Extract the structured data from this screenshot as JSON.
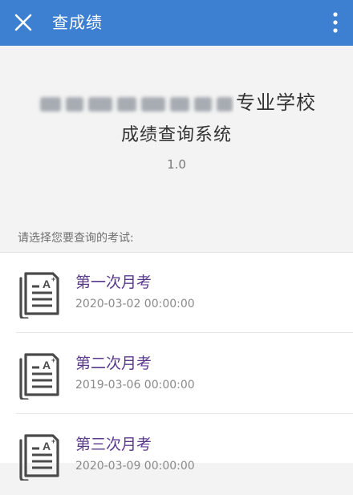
{
  "topbar": {
    "title": "查成绩",
    "close_icon": "close-icon",
    "more_icon": "more-vertical-icon",
    "color": "#3d7fd0"
  },
  "header": {
    "school_name_visible": "专业学校",
    "system_title": "成绩查询系统",
    "version": "1.0"
  },
  "prompt": "请选择您要查询的考试:",
  "exams": [
    {
      "name": "第一次月考",
      "date": "2020-03-02 00:00:00",
      "icon": "exam-paper-icon"
    },
    {
      "name": "第二次月考",
      "date": "2019-03-06 00:00:00",
      "icon": "exam-paper-icon"
    },
    {
      "name": "第三次月考",
      "date": "2020-03-09 00:00:00",
      "icon": "exam-paper-icon"
    }
  ],
  "colors": {
    "exam_name": "#5b3a8e",
    "background": "#f3f3f3"
  }
}
